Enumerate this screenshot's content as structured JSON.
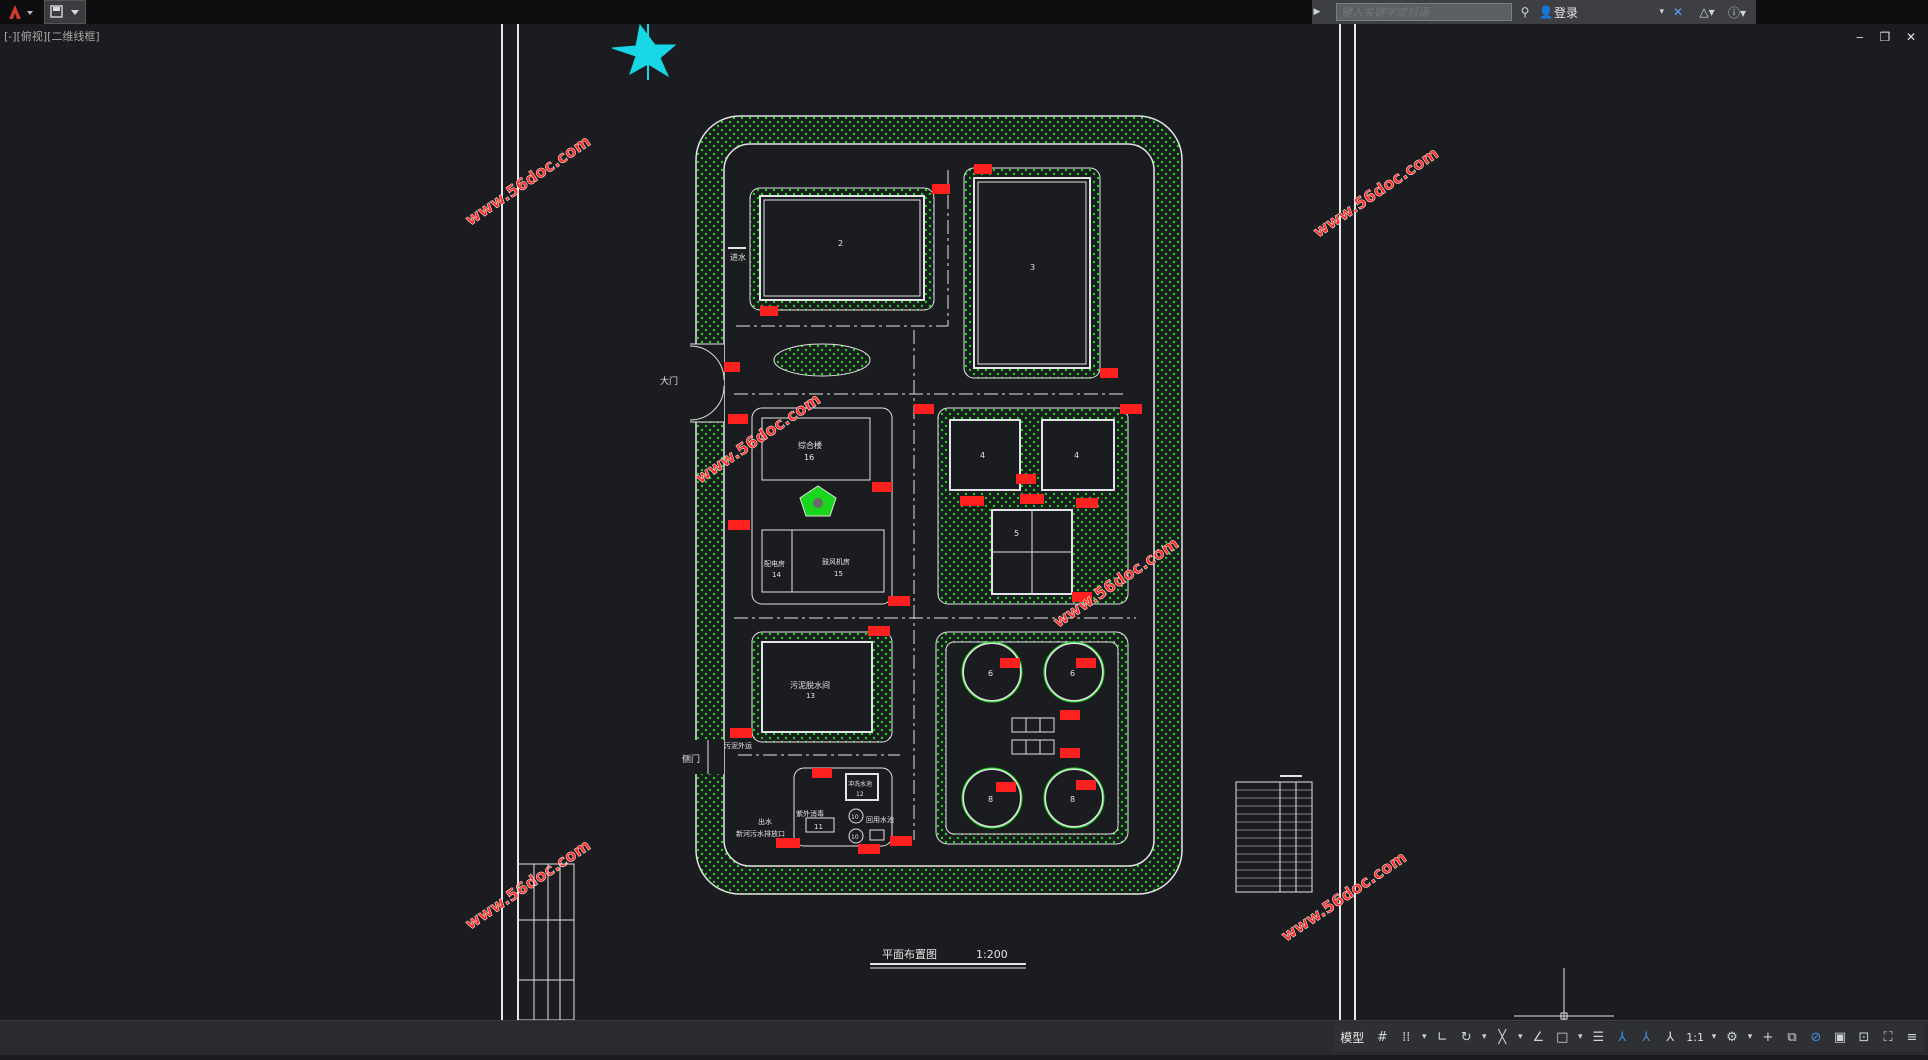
{
  "titlebar": {
    "app_menu_icon": "autocad-logo-icon",
    "quick_access_icon": "save-menu-icon",
    "search_placeholder": "键入关键字或短语",
    "login_label": "登录",
    "accent": "#d23a2e"
  },
  "viewport": {
    "label": "[-][俯视][二维线框]",
    "window_controls": "‒ ❐ ✕"
  },
  "drawing": {
    "plan_title": "平面布置图",
    "plan_scale": "1:200",
    "watermark": "www.56doc.com",
    "labels": {
      "gate_main": "大门",
      "gate_side": "侧门",
      "inlet": "进水",
      "bldg_2": "2",
      "bldg_3": "3",
      "tank_4a": "4",
      "tank_4b": "4",
      "tank_5": "5",
      "clar_6a": "6",
      "clar_6b": "6",
      "clar_8a": "8",
      "clar_8b": "8",
      "office": "综合楼",
      "office_num": "16",
      "power": "配电房",
      "power_num": "14",
      "blower": "鼓风机房",
      "blower_num": "15",
      "sludge": "污泥脱水间",
      "sludge_num": "13",
      "sludge_out": "污泥外运",
      "washwater": "冲洗水池",
      "washwater_num": "12",
      "uv": "紫外消毒",
      "uv_num": "11",
      "outlet1": "出水",
      "outlet2": "新河污水排放口",
      "reuse": "回用水池",
      "circle_10a": "10",
      "circle_10b": "10"
    },
    "colors": {
      "grass": "#17d61b",
      "line": "#e4e4e4",
      "tag": "#ff2020",
      "north": "#17d7e6",
      "watermark": "#ff2a22"
    }
  },
  "statusbar": {
    "model_tab": "模型",
    "scale": "1:1"
  }
}
